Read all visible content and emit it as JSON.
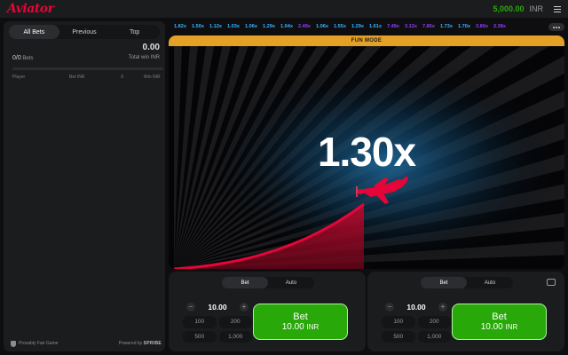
{
  "app": {
    "logo": "Aviator",
    "balance": "5,000.00",
    "currency": "INR"
  },
  "colors": {
    "accent_red": "#e50539",
    "balance_green": "#28a909",
    "fun_mode_amber": "#e5a125"
  },
  "left_panel": {
    "tabs": [
      {
        "label": "All Bets",
        "active": true
      },
      {
        "label": "Previous"
      },
      {
        "label": "Top"
      }
    ],
    "total_win_value": "0.00",
    "bets_count": "0/0",
    "bets_label": "Bets",
    "total_win_label": "Total win INR",
    "columns": {
      "player": "Player",
      "bet": "Bet INR",
      "x": "X",
      "win": "Win INR"
    },
    "footer": {
      "provably_fair": "Provably Fair Game",
      "powered_by": "Powered by",
      "brand": "SPRIBE"
    }
  },
  "history": [
    {
      "value": "1.82x",
      "color": "#34b4ff"
    },
    {
      "value": "1.50x",
      "color": "#34b4ff"
    },
    {
      "value": "1.12x",
      "color": "#34b4ff"
    },
    {
      "value": "1.03x",
      "color": "#34b4ff"
    },
    {
      "value": "1.06x",
      "color": "#34b4ff"
    },
    {
      "value": "1.29x",
      "color": "#34b4ff"
    },
    {
      "value": "1.04x",
      "color": "#34b4ff"
    },
    {
      "value": "2.49x",
      "color": "#913ef8"
    },
    {
      "value": "1.06x",
      "color": "#34b4ff"
    },
    {
      "value": "1.55x",
      "color": "#34b4ff"
    },
    {
      "value": "1.29x",
      "color": "#34b4ff"
    },
    {
      "value": "1.61x",
      "color": "#34b4ff"
    },
    {
      "value": "7.49x",
      "color": "#913ef8"
    },
    {
      "value": "3.12x",
      "color": "#913ef8"
    },
    {
      "value": "7.85x",
      "color": "#913ef8"
    },
    {
      "value": "1.73x",
      "color": "#34b4ff"
    },
    {
      "value": "1.70x",
      "color": "#34b4ff"
    },
    {
      "value": "3.80x",
      "color": "#913ef8"
    },
    {
      "value": "2.38x",
      "color": "#913ef8"
    }
  ],
  "game": {
    "mode_banner": "FUN MODE",
    "multiplier": "1.30x"
  },
  "bet_panels": [
    {
      "tabs": [
        "Bet",
        "Auto"
      ],
      "active_tab": "Bet",
      "stake": "10.00",
      "quick": [
        "100",
        "200",
        "500",
        "1,000"
      ],
      "bet_label": "Bet",
      "bet_amount": "10.00",
      "bet_currency": "INR"
    },
    {
      "tabs": [
        "Bet",
        "Auto"
      ],
      "active_tab": "Bet",
      "stake": "10.00",
      "quick": [
        "100",
        "200",
        "500",
        "1,000"
      ],
      "bet_label": "Bet",
      "bet_amount": "10.00",
      "bet_currency": "INR"
    }
  ],
  "icons": [
    "menu-icon",
    "more-icon",
    "plus-icon",
    "minus-icon",
    "shield-icon",
    "chat-icon",
    "plane-icon"
  ]
}
